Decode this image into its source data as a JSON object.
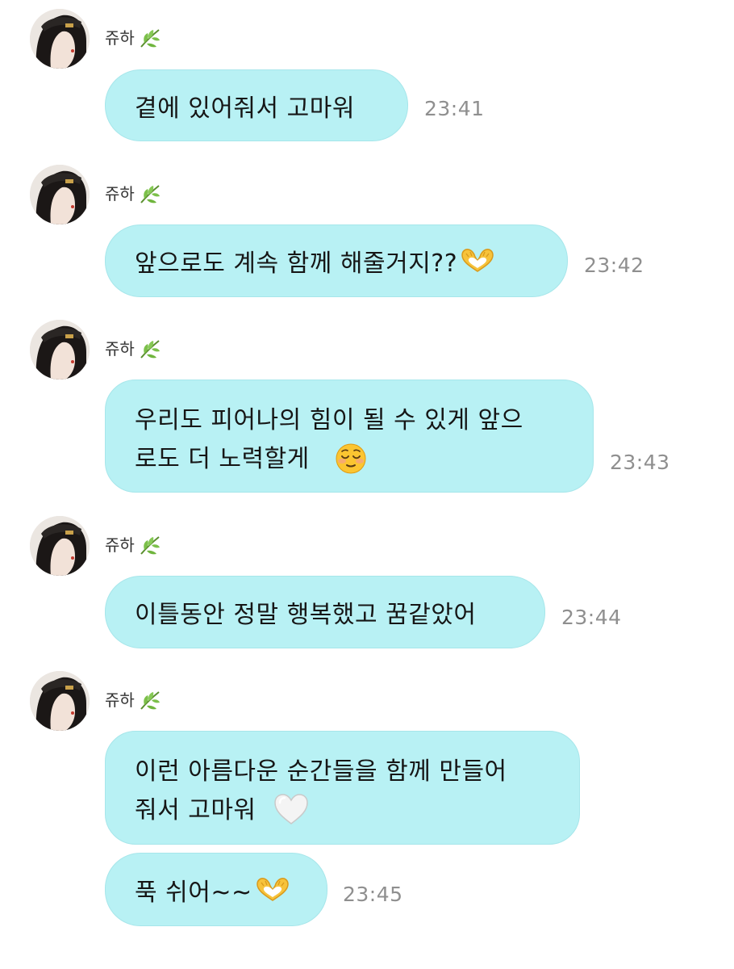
{
  "sender": {
    "name": "쥬하",
    "suffix_icon": "leaf-icon"
  },
  "colors": {
    "bubble_bg": "#b8f1f4",
    "bubble_border": "#a6e6ea",
    "timestamp": "#8f8f8f",
    "text": "#161616"
  },
  "messages": [
    {
      "text": "곁에 있어줘서 고마워",
      "emoji": "",
      "time": "23:41"
    },
    {
      "text": "앞으로도 계속 함께 해줄거지??",
      "emoji": "heart-hands-emoji",
      "time": "23:42"
    },
    {
      "text": "우리도 피어나의 힘이 될 수 있게 앞으\n로도 더 노력할게",
      "emoji": "relieved-face-emoji",
      "time": "23:43"
    },
    {
      "text": "이틀동안 정말 행복했고 꿈같았어",
      "emoji": "",
      "time": "23:44"
    },
    {
      "text": "이런 아름다운 순간들을 함께 만들어\n줘서 고마워",
      "emoji": "white-heart-emoji",
      "time": ""
    },
    {
      "text": "푹 쉬어~~",
      "emoji": "heart-hands-emoji",
      "time": "23:45"
    }
  ]
}
